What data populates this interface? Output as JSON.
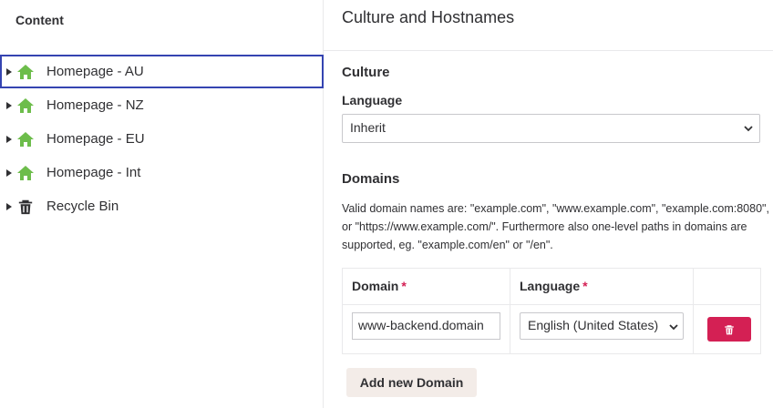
{
  "tree": {
    "header": "Content",
    "items": [
      {
        "label": "Homepage - AU",
        "icon": "home-icon",
        "selected": true
      },
      {
        "label": "Homepage - NZ",
        "icon": "home-icon",
        "selected": false
      },
      {
        "label": "Homepage - EU",
        "icon": "home-icon",
        "selected": false
      },
      {
        "label": "Homepage - Int",
        "icon": "home-icon",
        "selected": false
      },
      {
        "label": "Recycle Bin",
        "icon": "trash-icon",
        "selected": false
      }
    ]
  },
  "panel": {
    "title": "Culture and Hostnames",
    "culture": {
      "section_title": "Culture",
      "language_label": "Language",
      "language_value": "Inherit"
    },
    "domains": {
      "section_title": "Domains",
      "description": "Valid domain names are: \"example.com\", \"www.example.com\", \"example.com:8080\", or \"https://www.example.com/\". Furthermore also one-level paths in domains are supported, eg. \"example.com/en\" or \"/en\".",
      "columns": {
        "domain": "Domain",
        "language": "Language",
        "required_mark": "*"
      },
      "rows": [
        {
          "domain": "www-backend.domain",
          "language": "English (United States)"
        }
      ],
      "add_label": "Add new Domain"
    }
  },
  "colors": {
    "accent": "#3544b1",
    "danger": "#d42054",
    "home_icon": "#6dbd4b",
    "add_button_bg": "#f3ece8"
  }
}
